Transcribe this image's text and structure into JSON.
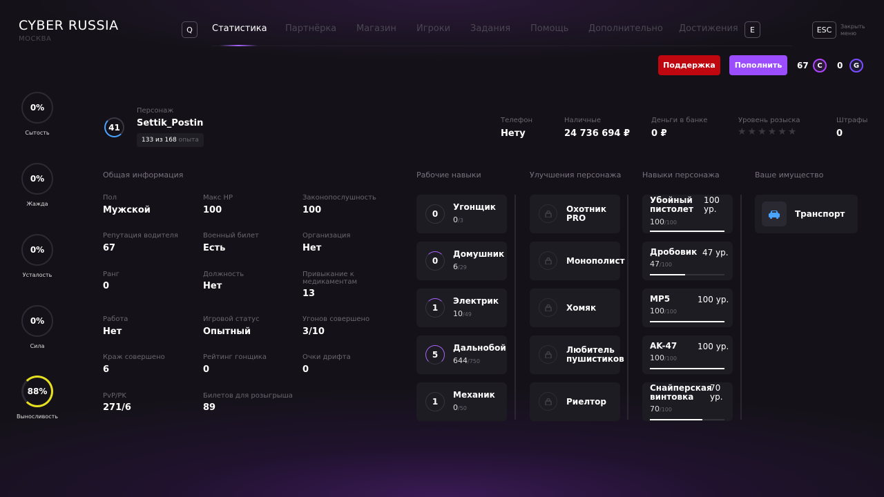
{
  "header": {
    "logo": "CYBER RUSSIA",
    "city": "МОСКВА",
    "key_left": "Q",
    "key_right": "E",
    "esc": "ESC",
    "close_menu": "Закрыть меню",
    "nav": [
      "Статистика",
      "Партнёрка",
      "Магазин",
      "Игроки",
      "Задания",
      "Помощь",
      "Дополнительно",
      "Достижения"
    ]
  },
  "actions": {
    "support": "Поддержка",
    "topup": "Пополнить",
    "c_amount": "67",
    "c_icon": "C",
    "g_amount": "0",
    "g_icon": "G",
    "support_color": "#c0060f",
    "topup_color": "#9b4dff"
  },
  "stats": [
    {
      "value": "0%",
      "label": "Сытость",
      "fill": 0
    },
    {
      "value": "0%",
      "label": "Жажда",
      "fill": 0
    },
    {
      "value": "0%",
      "label": "Усталость",
      "fill": 0
    },
    {
      "value": "0%",
      "label": "Сила",
      "fill": 0
    },
    {
      "value": "88%",
      "label": "Выносливость",
      "fill": 0.88,
      "color": "#e6e020"
    }
  ],
  "character": {
    "label": "Персонаж",
    "name": "Settik_Postin",
    "level": "41",
    "exp": "133 из 168",
    "exp_suffix": "опыта",
    "exp_fraction": 0.79
  },
  "top_info": [
    {
      "label": "Телефон",
      "value": "Нету"
    },
    {
      "label": "Наличные",
      "value": "24 736 694 ₽"
    },
    {
      "label": "Деньги в банке",
      "value": "0 ₽"
    },
    {
      "label": "Уровень розыска",
      "stars": "★★★★★★",
      "wanted": 0
    },
    {
      "label": "Штрафы",
      "value": "0"
    }
  ],
  "general": {
    "title": "Общая информация",
    "items": [
      {
        "label": "Пол",
        "value": "Мужской"
      },
      {
        "label": "Макс HP",
        "value": "100"
      },
      {
        "label": "Законопослушность",
        "value": "100"
      },
      {
        "label": "Репутация водителя",
        "value": "67"
      },
      {
        "label": "Военный билет",
        "value": "Есть"
      },
      {
        "label": "Организация",
        "value": "Нет"
      },
      {
        "label": "Ранг",
        "value": "0"
      },
      {
        "label": "Должность",
        "value": "Нет"
      },
      {
        "label": "Привыкание к медикаментам",
        "value": "13"
      },
      {
        "label": "Работа",
        "value": "Нет"
      },
      {
        "label": "Игровой статус",
        "value": "Опытный"
      },
      {
        "label": "Угонов совершено",
        "value": "3/10"
      },
      {
        "label": "Краж совершено",
        "value": "6"
      },
      {
        "label": "Рейтинг гонщика",
        "value": "0"
      },
      {
        "label": "Очки дрифта",
        "value": "0"
      },
      {
        "label": "PvP/PK",
        "value": "271/6"
      },
      {
        "label": "Билетов для розыгрыша",
        "value": "89"
      }
    ]
  },
  "work_skills": {
    "title": "Рабочие навыки",
    "items": [
      {
        "level": "0",
        "name": "Угонщик",
        "cur": "0",
        "max": "/3",
        "fill": 0
      },
      {
        "level": "0",
        "name": "Домушник",
        "cur": "6",
        "max": "/29",
        "fill": 0.21
      },
      {
        "level": "1",
        "name": "Электрик",
        "cur": "10",
        "max": "/49",
        "fill": 0.2
      },
      {
        "level": "5",
        "name": "Дальнобой",
        "cur": "644",
        "max": "/750",
        "fill": 0.86
      },
      {
        "level": "1",
        "name": "Механик",
        "cur": "0",
        "max": "/50",
        "fill": 0
      }
    ]
  },
  "upgrades": {
    "title": "Улучшения персонажа",
    "items": [
      "Охотник PRO",
      "Монополист",
      "Хомяк",
      "Любитель пушистиков",
      "Риелтор"
    ]
  },
  "char_skills": {
    "title": "Навыки персонажа",
    "items": [
      {
        "name": "Убойный пистолет",
        "level": "100 ур.",
        "cur": "100",
        "max": "/100",
        "fill": 1
      },
      {
        "name": "Дробовик",
        "level": "47 ур.",
        "cur": "47",
        "max": "/100",
        "fill": 0.47
      },
      {
        "name": "MP5",
        "level": "100 ур.",
        "cur": "100",
        "max": "/100",
        "fill": 1
      },
      {
        "name": "AK-47",
        "level": "100 ур.",
        "cur": "100",
        "max": "/100",
        "fill": 1
      },
      {
        "name": "Снайперская винтовка",
        "level": "70 ур.",
        "cur": "70",
        "max": "/100",
        "fill": 0.7
      }
    ]
  },
  "property": {
    "title": "Ваше имущество",
    "items": [
      "Транспорт"
    ]
  }
}
